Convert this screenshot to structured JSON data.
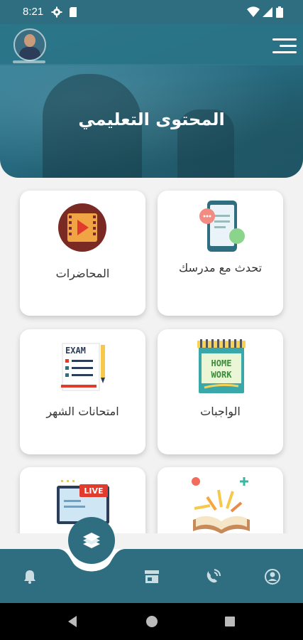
{
  "status_bar": {
    "time": "8:21",
    "icons": [
      "settings-icon",
      "sd-card-icon",
      "wifi-icon",
      "signal-icon",
      "battery-icon"
    ]
  },
  "header": {
    "title": "المحتوى التعليمي",
    "menu_icon": "hamburger-menu-icon",
    "avatar": "teacher-avatar"
  },
  "cards": [
    {
      "id": "chat",
      "label": "تحدث مع مدرسك",
      "icon": "chat-phone-icon"
    },
    {
      "id": "lectures",
      "label": "المحاضرات",
      "icon": "video-play-icon"
    },
    {
      "id": "homework",
      "label": "الواجبات",
      "icon": "homework-notebook-icon",
      "icon_text": [
        "HOME",
        "WORK"
      ]
    },
    {
      "id": "exams",
      "label": "امتحانات الشهر",
      "icon": "exam-sheet-icon",
      "icon_text": "EXAM"
    },
    {
      "id": "open-book",
      "label": "",
      "icon": "open-book-icon"
    },
    {
      "id": "live",
      "label": "",
      "icon": "live-monitor-icon",
      "icon_text": "LIVE"
    }
  ],
  "bottom_nav": {
    "items": [
      "profile-icon",
      "support-icon",
      "store-icon",
      "notification-bell-icon"
    ],
    "center_fab": "books-icon"
  },
  "colors": {
    "primary": "#2f6e80",
    "card_bg": "#ffffff",
    "page_bg": "#f2f2f2"
  }
}
